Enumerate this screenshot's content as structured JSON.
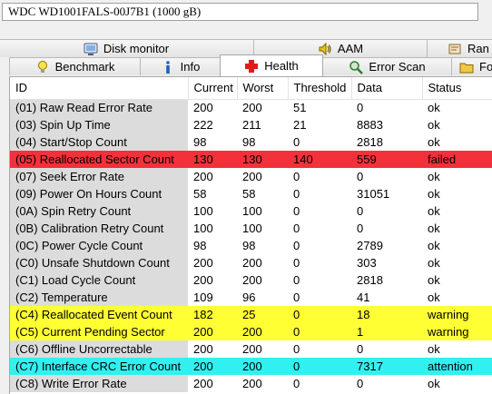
{
  "drive": {
    "selected": "WDC WD1001FALS-00J7B1 (1000 gB)"
  },
  "tabs_top": [
    {
      "label": "Disk monitor",
      "icon": "disk-monitor-icon"
    },
    {
      "label": "AAM",
      "icon": "speaker-icon"
    },
    {
      "label": "Ran",
      "icon": "random-access-icon"
    }
  ],
  "tabs_bottom": [
    {
      "label": "Benchmark",
      "icon": "lightbulb-icon"
    },
    {
      "label": "Info",
      "icon": "info-icon"
    },
    {
      "label": "Health",
      "icon": "health-cross-icon"
    },
    {
      "label": "Error Scan",
      "icon": "magnifier-icon"
    },
    {
      "label": "Fo",
      "icon": "folder-icon"
    }
  ],
  "active_tab": "Health",
  "table": {
    "headers": [
      "ID",
      "Current",
      "Worst",
      "Threshold",
      "Data",
      "Status"
    ],
    "rows": [
      {
        "id": "(01) Raw Read Error Rate",
        "current": "200",
        "worst": "200",
        "threshold": "51",
        "data": "0",
        "status": "ok",
        "level": "ok"
      },
      {
        "id": "(03) Spin Up Time",
        "current": "222",
        "worst": "211",
        "threshold": "21",
        "data": "8883",
        "status": "ok",
        "level": "ok"
      },
      {
        "id": "(04) Start/Stop Count",
        "current": "98",
        "worst": "98",
        "threshold": "0",
        "data": "2818",
        "status": "ok",
        "level": "ok"
      },
      {
        "id": "(05) Reallocated Sector Count",
        "current": "130",
        "worst": "130",
        "threshold": "140",
        "data": "559",
        "status": "failed",
        "level": "failed"
      },
      {
        "id": "(07) Seek Error Rate",
        "current": "200",
        "worst": "200",
        "threshold": "0",
        "data": "0",
        "status": "ok",
        "level": "ok"
      },
      {
        "id": "(09) Power On Hours Count",
        "current": "58",
        "worst": "58",
        "threshold": "0",
        "data": "31051",
        "status": "ok",
        "level": "ok"
      },
      {
        "id": "(0A) Spin Retry Count",
        "current": "100",
        "worst": "100",
        "threshold": "0",
        "data": "0",
        "status": "ok",
        "level": "ok"
      },
      {
        "id": "(0B) Calibration Retry Count",
        "current": "100",
        "worst": "100",
        "threshold": "0",
        "data": "0",
        "status": "ok",
        "level": "ok"
      },
      {
        "id": "(0C) Power Cycle Count",
        "current": "98",
        "worst": "98",
        "threshold": "0",
        "data": "2789",
        "status": "ok",
        "level": "ok"
      },
      {
        "id": "(C0) Unsafe Shutdown Count",
        "current": "200",
        "worst": "200",
        "threshold": "0",
        "data": "303",
        "status": "ok",
        "level": "ok"
      },
      {
        "id": "(C1) Load Cycle Count",
        "current": "200",
        "worst": "200",
        "threshold": "0",
        "data": "2818",
        "status": "ok",
        "level": "ok"
      },
      {
        "id": "(C2) Temperature",
        "current": "109",
        "worst": "96",
        "threshold": "0",
        "data": "41",
        "status": "ok",
        "level": "ok"
      },
      {
        "id": "(C4) Reallocated Event Count",
        "current": "182",
        "worst": "25",
        "threshold": "0",
        "data": "18",
        "status": "warning",
        "level": "warning"
      },
      {
        "id": "(C5) Current Pending Sector",
        "current": "200",
        "worst": "200",
        "threshold": "0",
        "data": "1",
        "status": "warning",
        "level": "warning"
      },
      {
        "id": "(C6) Offline Uncorrectable",
        "current": "200",
        "worst": "200",
        "threshold": "0",
        "data": "0",
        "status": "ok",
        "level": "ok"
      },
      {
        "id": "(C7) Interface CRC Error Count",
        "current": "200",
        "worst": "200",
        "threshold": "0",
        "data": "7317",
        "status": "attention",
        "level": "attention"
      },
      {
        "id": "(C8) Write Error Rate",
        "current": "200",
        "worst": "200",
        "threshold": "0",
        "data": "0",
        "status": "ok",
        "level": "ok"
      }
    ]
  },
  "colors": {
    "failed": "#f2313a",
    "warning": "#ffff33",
    "attention": "#33f0f0",
    "id_column": "#dcdcdc"
  }
}
